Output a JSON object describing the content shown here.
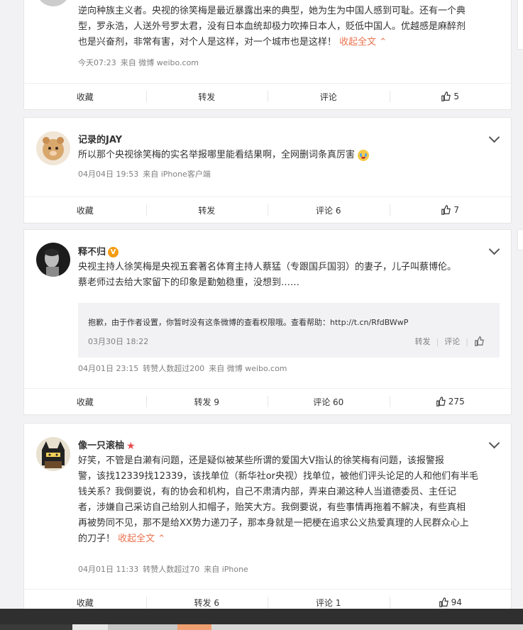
{
  "posts": [
    {
      "content_lines": [
        "逆向种族主义者。央视的徐笑梅是最近暴露出来的典型，她为生为中国人感到可耻。还有一个典",
        "型，罗永浩，人送外号罗太君，没有日本血统却极力吹捧日本人，贬低中国人。优越感是麻醉剂",
        "也是兴奋剂，非常有害，对个人是这样，对一个城市也是这样！"
      ],
      "collapse": "收起全文",
      "time": "今天07:23",
      "source": "来自 微博 weibo.com",
      "actions": {
        "fav": "收藏",
        "repost": "转发",
        "comment": "评论",
        "like": "5"
      }
    },
    {
      "name": "记录的JAY",
      "content": "所以那个央视徐笑梅的实名举报哪里能看结果啊，全网删词条真厉害",
      "time": "04月04日 19:53",
      "source": "来自 iPhone客户端",
      "actions": {
        "fav": "收藏",
        "repost": "转发",
        "comment": "评论 6",
        "like": "7"
      }
    },
    {
      "name": "释不归",
      "badge": "V",
      "content_lines": [
        "央视主持人徐笑梅是央视五套著名体育主持人蔡猛（专跟国乒国羽）的妻子，儿子叫蔡博伦。",
        "蔡老师过去给大家留下的印象是勤勉稳重，没想到……"
      ],
      "repost": {
        "text": "抱歉，由于作者设置，你暂时没有这条微博的查看权限哦。查看帮助：http://t.cn/RfdBWwP",
        "time": "03月30日 18:22",
        "repost": "转发",
        "comment": "评论"
      },
      "time": "04月01日 23:15",
      "reposts_info": "转赞人数超过200",
      "source": "来自 微博 weibo.com",
      "actions": {
        "fav": "收藏",
        "repost": "转发 9",
        "comment": "评论 60",
        "like": "275"
      }
    },
    {
      "name": "像一只滚柚",
      "content_lines": [
        "好笑，不管是白濑有问题，还是疑似被某些所谓的爱国大V指认的徐笑梅有问题，该报警报",
        "警，该找12339找12339，该找单位（新华社or央视）找单位，被他们评头论足的人和他们有半毛",
        "钱关系？我倒要说，有的协会和机构，自己不肃清内部，弄来白濑这种人当道德委员、主任记",
        "者，涉嫌自己采访自己给别人扣帽子，贻笑大方。我倒要说，有些事情再拖着不解决，有些真相",
        "再被势同不见，那不是给XX势力递刀子，那本身就是一把梗在追求公义热爱真理的人民群众心上",
        "的刀子！"
      ],
      "collapse": "收起全文",
      "time": "04月01日 11:33",
      "reposts_info": "转赞人数超过70",
      "source": "来自 iPhone",
      "actions": {
        "fav": "收藏",
        "repost": "转发 6",
        "comment": "评论 1",
        "like": "94"
      }
    }
  ]
}
